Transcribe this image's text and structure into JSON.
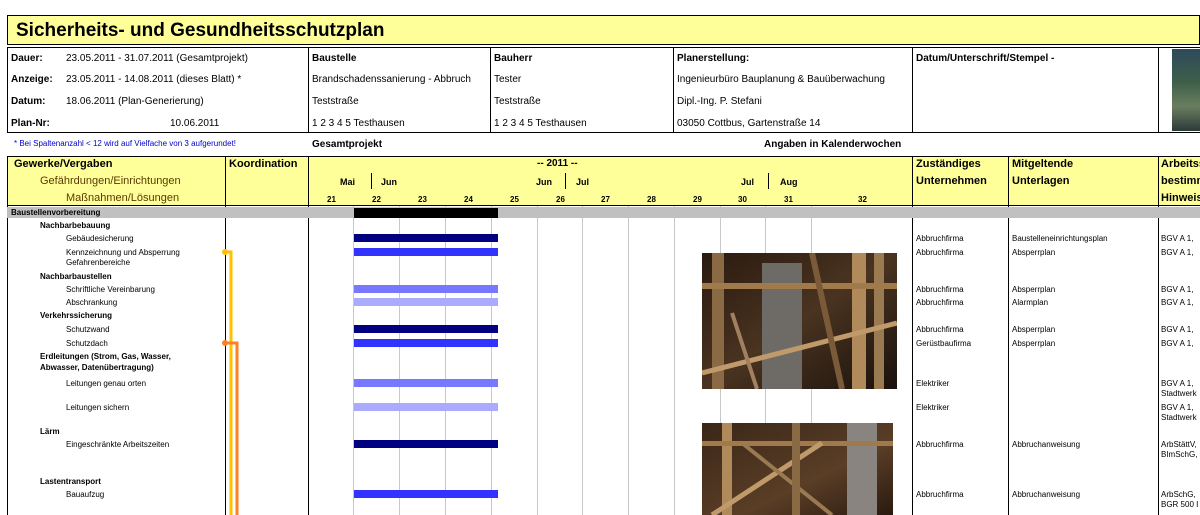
{
  "title": "Sicherheits- und Gesundheitsschutzplan",
  "info": {
    "dauer_label": "Dauer:",
    "dauer_value": "23.05.2011 - 31.07.2011 (Gesamtprojekt)",
    "anzeige_label": "Anzeige:",
    "anzeige_value": "23.05.2011 - 14.08.2011 (dieses Blatt) *",
    "datum_label": "Datum:",
    "datum_value": "18.06.2011 (Plan-Generierung)",
    "plannr_label": "Plan-Nr:",
    "plannr_value": "10.06.2011",
    "baustelle_label": "Baustelle",
    "baustelle_l1": "Brandschadenssanierung - Abbruch",
    "baustelle_l2": "Teststraße",
    "baustelle_l3": "1 2 3 4 5 Testhausen",
    "bauherr_label": "Bauherr",
    "bauherr_l1": "Tester",
    "bauherr_l2": "Teststraße",
    "bauherr_l3": "1 2 3 4 5  Testhausen",
    "planer_label": "Planerstellung:",
    "planer_l1": "Ingenieurbüro Bauplanung & Bauüberwachung",
    "planer_l2": "Dipl.-Ing. P. Stefani",
    "planer_l3": "03050 Cottbus, Gartenstraße 14",
    "datum_unterschrift": "Datum/Unterschrift/Stempel -"
  },
  "note": "* Bei Spaltenanzahl < 12 wird auf Vielfache von 3 aufgerundet!",
  "gesamtprojekt": "Gesamtprojekt",
  "angaben": "Angaben in Kalenderwochen",
  "header": {
    "col1_l1": "Gewerke/Vergaben",
    "col1_l2": "Gefährdungen/Einrichtungen",
    "col1_l3": "Maßnahmen/Lösungen",
    "koordination": "Koordination",
    "year": "-- 2011 --",
    "months": [
      "Mai",
      "Jun",
      "Jun",
      "Jul",
      "Jul",
      "Aug"
    ],
    "weeks": [
      "21",
      "22",
      "23",
      "24",
      "25",
      "26",
      "27",
      "28",
      "29",
      "30",
      "31",
      "32"
    ],
    "unternehmen_l1": "Zuständiges",
    "unternehmen_l2": "Unternehmen",
    "unterlagen_l1": "Mitgeltende",
    "unterlagen_l2": "Unterlagen",
    "arbeit_l1": "Arbeitss",
    "arbeit_l2": "bestimm",
    "arbeit_l3": "Hinweis"
  },
  "rows": {
    "s1": "Baustellenvorbereitung",
    "g1": "Nachbarbebauung",
    "r1": "Gebäudesicherung",
    "r1_u": "Abbruchfirma",
    "r1_m": "Baustelleneinrichtungsplan",
    "r1_a": "BGV A 1,",
    "r2": "Kennzeichnung und Absperrung",
    "r2b": "Gefahrenbereiche",
    "r2_u": "Abbruchfirma",
    "r2_m": "Absperrplan",
    "r2_a": "BGV A 1,",
    "g2": "Nachbarbaustellen",
    "r3": "Schriftliche Vereinbarung",
    "r3_u": "Abbruchfirma",
    "r3_m": "Absperrplan",
    "r3_a": "BGV A 1,",
    "r4": "Abschrankung",
    "r4_u": "Abbruchfirma",
    "r4_m": "Alarmplan",
    "r4_a": "BGV A 1,",
    "g3": "Verkehrssicherung",
    "r5": "Schutzwand",
    "r5_u": "Abbruchfirma",
    "r5_m": "Absperrplan",
    "r5_a": "BGV A 1,",
    "r6": "Schutzdach",
    "r6_u": "Gerüstbaufirma",
    "r6_m": "Absperrplan",
    "r6_a": "BGV A 1,",
    "g4a": "Erdleitungen (Strom, Gas, Wasser,",
    "g4b": "Abwasser, Datenübertragung)",
    "r7": "Leitungen genau orten",
    "r7_u": "Elektriker",
    "r7_a1": "BGV A 1,",
    "r7_a2": "Stadtwerk",
    "r8": "Leitungen sichern",
    "r8_u": "Elektriker",
    "r8_a1": "BGV A 1,",
    "r8_a2": "Stadtwerk",
    "g5": "Lärm",
    "r9": "Eingeschränkte Arbeitszeiten",
    "r9_u": "Abbruchfirma",
    "r9_m": "Abbruchanweisung",
    "r9_a1": "ArbStättV,",
    "r9_a2": "BImSchG,",
    "g6": "Lastentransport",
    "r10": "Bauaufzug",
    "r10_u": "Abbruchfirma",
    "r10_m": "Abbruchanweisung",
    "r10_a1": "ArbSchG,",
    "r10_a2": "BGR 500 I"
  },
  "colors": {
    "band": "#ffff99",
    "section": "#c0c0c0",
    "bar_black": "#000000",
    "bar_navy": "#000080",
    "bar_blue": "#3333ff",
    "bar_mid": "#7777ff",
    "bar_light": "#aaaaff",
    "koord_yellow": "#ffc000",
    "koord_orange": "#ff7f27"
  }
}
